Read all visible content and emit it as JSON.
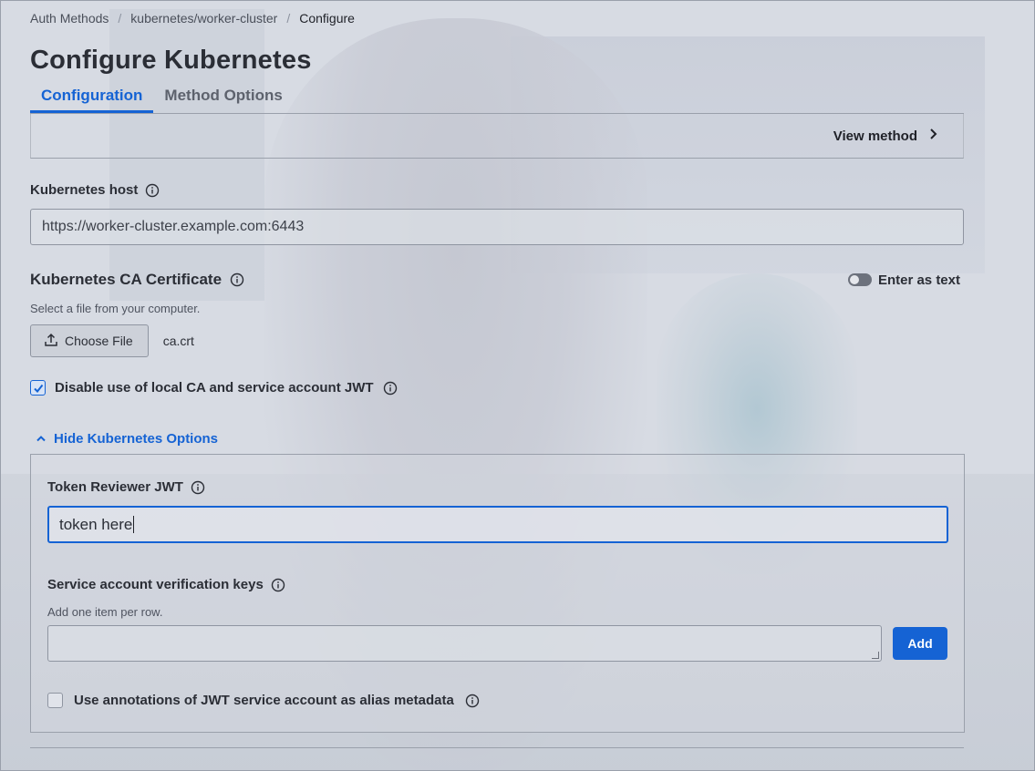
{
  "breadcrumb": {
    "items": [
      "Auth Methods",
      "kubernetes/worker-cluster"
    ],
    "current": "Configure",
    "separator": "/"
  },
  "page": {
    "title": "Configure Kubernetes"
  },
  "tabs": [
    {
      "label": "Configuration",
      "active": true
    },
    {
      "label": "Method Options",
      "active": false
    }
  ],
  "toolbar": {
    "view_method_label": "View method",
    "view_method_icon": "chevron-right-icon"
  },
  "kubernetes_host": {
    "label": "Kubernetes host",
    "value": "https://worker-cluster.example.com:6443",
    "icon": "info-icon"
  },
  "ca_certificate": {
    "title": "Kubernetes CA Certificate",
    "toggle_label": "Enter as text",
    "toggle_on": false,
    "helper": "Select a file from your computer.",
    "choose_file_label": "Choose File",
    "file_name": "ca.crt",
    "upload_icon": "upload-icon"
  },
  "disable_local_ca": {
    "label": "Disable use of local CA and service account JWT",
    "checked": true
  },
  "options_toggle": {
    "label": "Hide Kubernetes Options",
    "icon": "chevron-up-icon"
  },
  "token_reviewer": {
    "label": "Token Reviewer JWT",
    "value": "token here"
  },
  "verification_keys": {
    "label": "Service account verification keys",
    "helper": "Add one item per row.",
    "value": "",
    "add_label": "Add"
  },
  "annotations": {
    "label": "Use annotations of JWT service account as alias metadata",
    "checked": false
  },
  "colors": {
    "accent": "#1563d4",
    "text": "#1f2128",
    "border": "#9aa0ab"
  }
}
